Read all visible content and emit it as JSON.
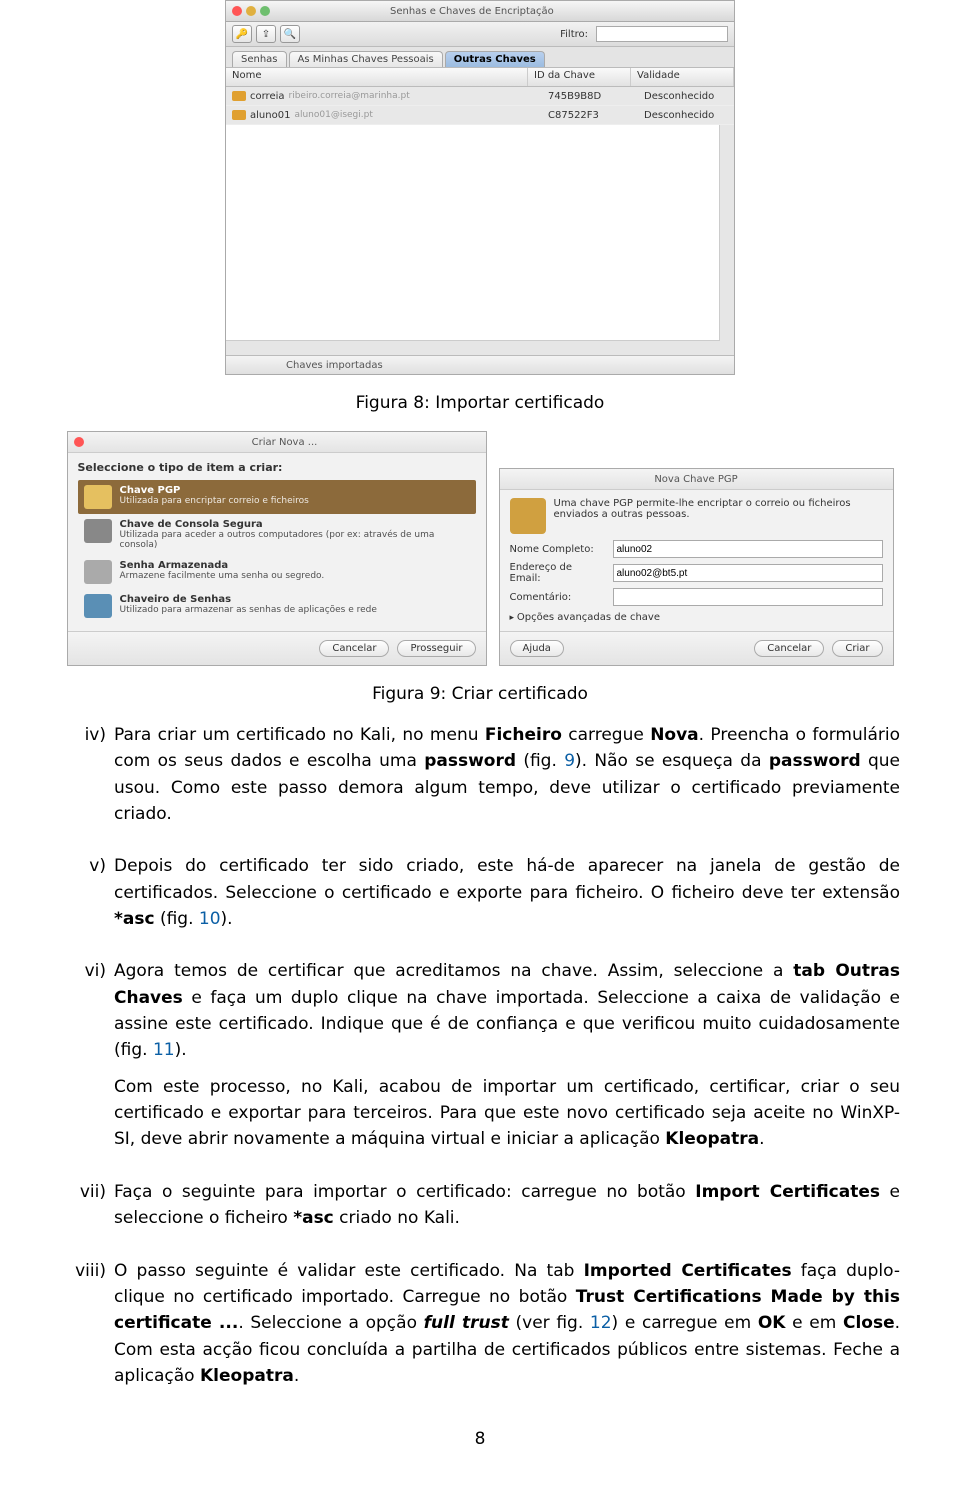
{
  "window1": {
    "title": "Senhas e Chaves de Encriptação",
    "filter_label": "Filtro:",
    "tabs": [
      "Senhas",
      "As Minhas Chaves Pessoais",
      "Outras Chaves"
    ],
    "headers": {
      "name": "Nome",
      "id": "ID da Chave",
      "validity": "Validade"
    },
    "rows": [
      {
        "name": "correia",
        "email": "ribeiro.correia@marinha.pt",
        "id": "745B9B8D",
        "validity": "Desconhecido"
      },
      {
        "name": "aluno01",
        "email": "aluno01@isegi.pt",
        "id": "C87522F3",
        "validity": "Desconhecido"
      }
    ],
    "status": "Chaves importadas"
  },
  "caption1": "Figura 8: Importar certificado",
  "dlg_new": {
    "title": "Criar Nova ...",
    "subtitle": "Seleccione o tipo de item a criar:",
    "opts": [
      {
        "t": "Chave PGP",
        "d": "Utilizada para encriptar correio e ficheiros"
      },
      {
        "t": "Chave de Consola Segura",
        "d": "Utilizada para aceder a outros computadores (por ex: através de uma consola)"
      },
      {
        "t": "Senha Armazenada",
        "d": "Armazene facilmente uma senha ou segredo."
      },
      {
        "t": "Chaveiro de Senhas",
        "d": "Utilizado para armazenar as senhas de aplicações e rede"
      }
    ],
    "cancel": "Cancelar",
    "continue": "Prosseguir"
  },
  "dlg_pgp": {
    "title": "Nova Chave PGP",
    "intro": "Uma chave PGP permite-lhe encriptar o correio ou ficheiros enviados a outras pessoas.",
    "name_label": "Nome Completo:",
    "name_val": "aluno02",
    "email_label": "Endereço de Email:",
    "email_val": "aluno02@bt5.pt",
    "comment_label": "Comentário:",
    "comment_val": "",
    "adv": "Opções avançadas de chave",
    "help": "Ajuda",
    "cancel": "Cancelar",
    "create": "Criar"
  },
  "caption2": "Figura 9: Criar certificado",
  "items": {
    "iv": {
      "n": "iv)",
      "text": "Para criar um certificado no Kali, no menu <b>Ficheiro</b> carregue <b>Nova</b>. Preencha o formulário com os seus dados e escolha uma <b>password</b> (fig. <span class=\"link\">9</span>). Não se esqueça da <b>password</b> que usou. Como este passo demora algum tempo, deve utilizar o certificado previamente criado."
    },
    "v": {
      "n": "v)",
      "text": "Depois do certificado ter sido criado, este há-de aparecer na janela de gestão de certificados. Seleccione o certificado e exporte para ficheiro. O ficheiro deve ter extensão <b>*asc</b> (fig. <span class=\"link\">10</span>)."
    },
    "vi": {
      "n": "vi)",
      "p1": "Agora temos de certificar que acreditamos na chave. Assim, seleccione a <b>tab Outras Chaves</b> e faça um duplo clique na chave importada. Seleccione a caixa de validação e assine este certificado. Indique que é de confiança e que verificou muito cuidadosamente (fig. <span class=\"link\">11</span>).",
      "p2": "Com este processo, no Kali, acabou de importar um certificado, certificar, criar o seu certificado e exportar para terceiros. Para que este novo certificado seja aceite no WinXP-SI, deve abrir novamente a máquina virtual e iniciar a aplicação <b>Kleopatra</b>."
    },
    "vii": {
      "n": "vii)",
      "text": "Faça o seguinte para importar o certificado: carregue no botão <b>Import Certificates</b> e seleccione o ficheiro <b>*asc</b> criado no Kali."
    },
    "viii": {
      "n": "viii)",
      "text": "O passo seguinte é validar este certificado. Na tab <b>Imported Certificates</b> faça duplo-clique no certificado importado. Carregue no botão <b>Trust Certifications Made by this certificate ...</b>. Seleccione a opção <b><i>full trust</i></b> (ver fig. <span class=\"link\">12</span>) e carregue em <b>OK</b> e em <b>Close</b>. Com esta acção ficou concluída a partilha de certificados públicos entre sistemas. Feche a aplicação <b>Kleopatra</b>."
    }
  },
  "page_number": "8"
}
